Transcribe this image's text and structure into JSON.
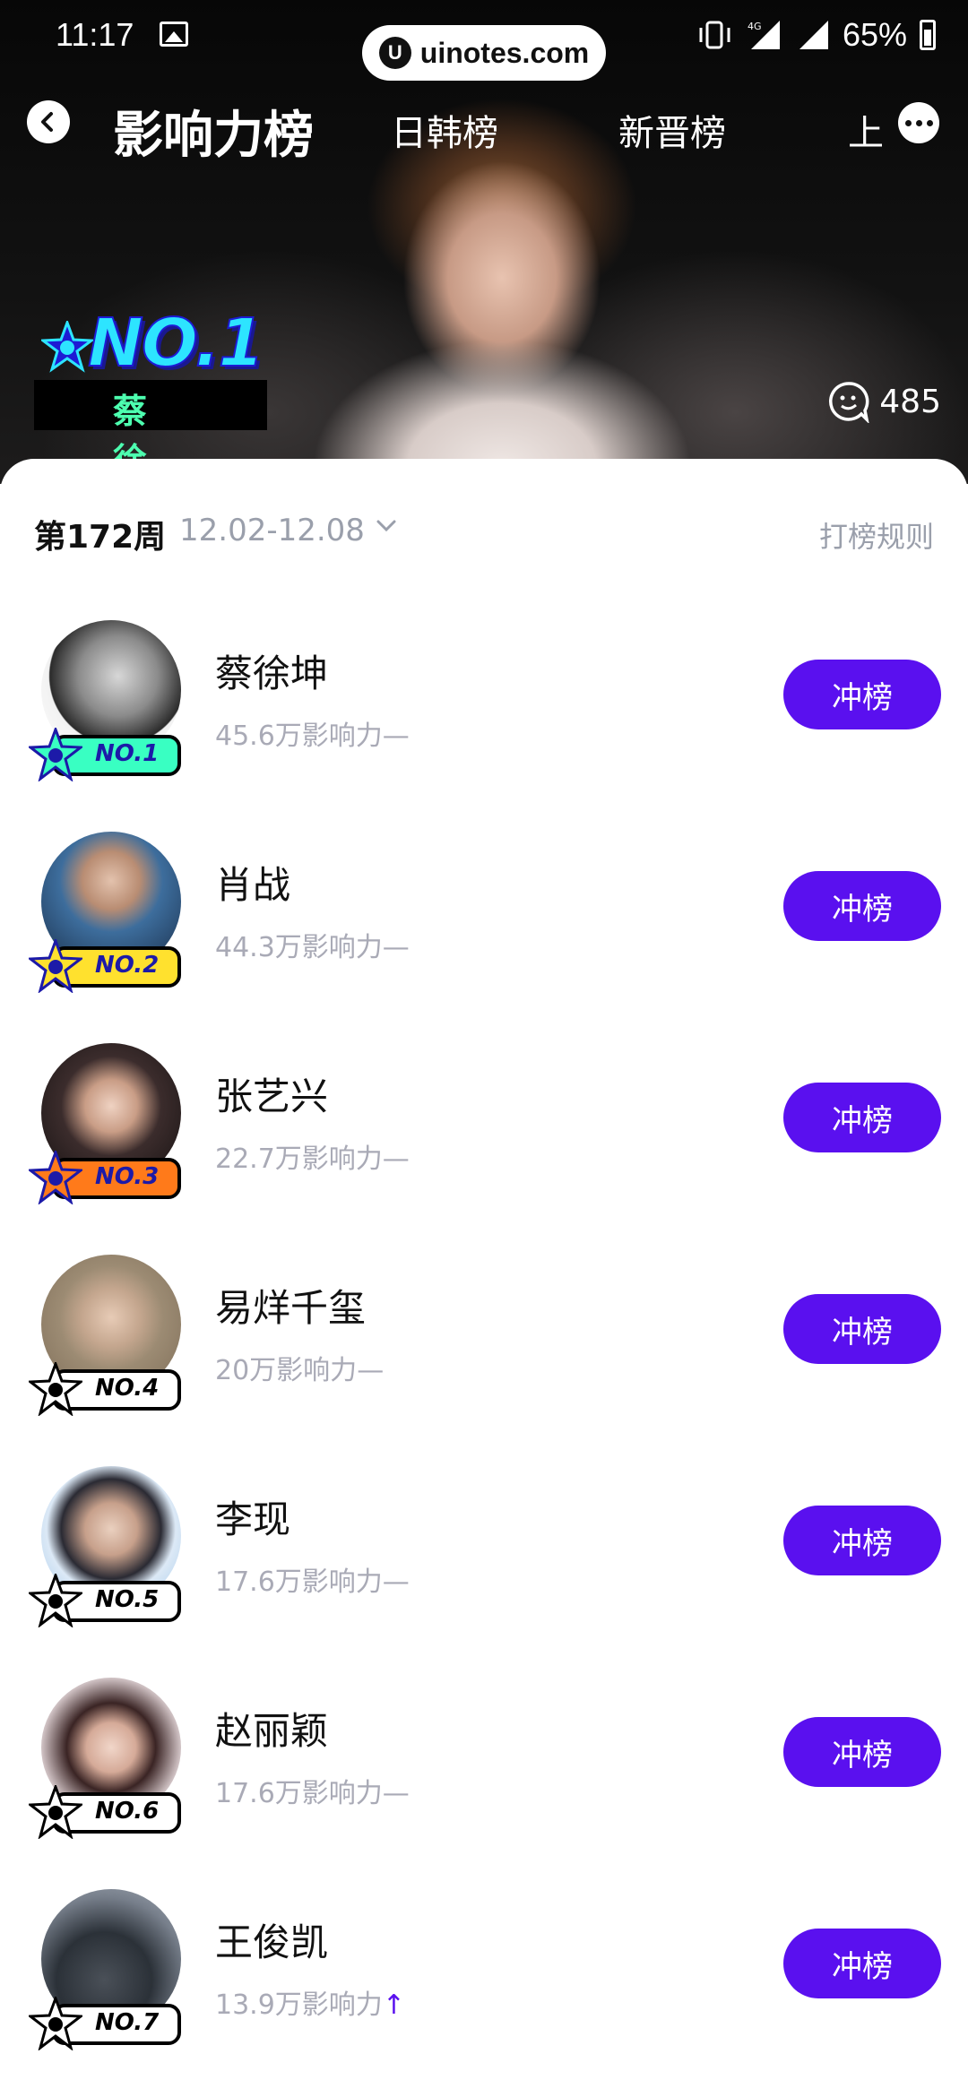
{
  "status_bar": {
    "time": "11:17",
    "battery": "65%",
    "network": "4G"
  },
  "watermark": {
    "text": "uinotes.com",
    "logo": "U"
  },
  "nav": {
    "title": "影响力榜",
    "tabs": [
      "日韩榜",
      "新晋榜",
      "上"
    ]
  },
  "hero": {
    "badge": "NO.1",
    "champion_name": "蔡徐坤",
    "comment_count": "485"
  },
  "week": {
    "label": "第172周",
    "range": "12.02-12.08",
    "rules": "打榜规则"
  },
  "colors": {
    "accent": "#5a10ef",
    "no1": "#39ffc2",
    "no2": "#ffe12e",
    "no3": "#ff7a1a",
    "other": "#ffffff"
  },
  "rankings": [
    {
      "rank": "NO.1",
      "name": "蔡徐坤",
      "score": "45.6万影响力",
      "trend": "—",
      "button": "冲榜"
    },
    {
      "rank": "NO.2",
      "name": "肖战",
      "score": "44.3万影响力",
      "trend": "—",
      "button": "冲榜"
    },
    {
      "rank": "NO.3",
      "name": "张艺兴",
      "score": "22.7万影响力",
      "trend": "—",
      "button": "冲榜"
    },
    {
      "rank": "NO.4",
      "name": "易烊千玺",
      "score": "20万影响力",
      "trend": "—",
      "button": "冲榜"
    },
    {
      "rank": "NO.5",
      "name": "李现",
      "score": "17.6万影响力",
      "trend": "—",
      "button": "冲榜"
    },
    {
      "rank": "NO.6",
      "name": "赵丽颖",
      "score": "17.6万影响力",
      "trend": "—",
      "button": "冲榜"
    },
    {
      "rank": "NO.7",
      "name": "王俊凯",
      "score": "13.9万影响力",
      "trend": "↑",
      "button": "冲榜"
    }
  ]
}
